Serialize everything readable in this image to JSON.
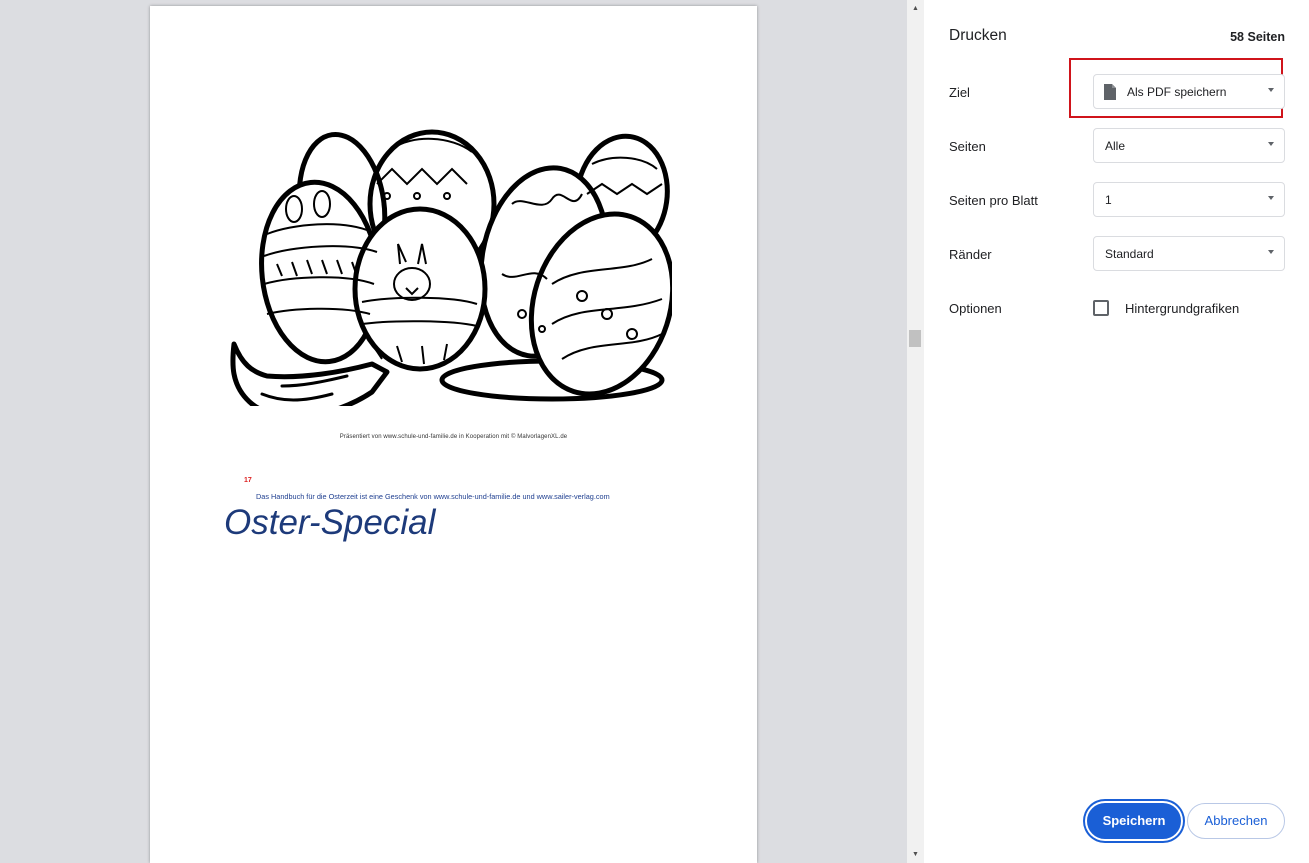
{
  "preview": {
    "credit_line": "Präsentiert von www.schule-und-familie.de in Kooperation mit © MalvorlagenXL.de",
    "page_number": "17",
    "handbook_text": "Das Handbuch für die Osterzeit ist eine Geschenk von www.schule-und-familie.de und www.sailer-verlag.com",
    "headline": "Oster-Special"
  },
  "panel": {
    "title": "Drucken",
    "page_count": "58 Seiten",
    "rows": {
      "destination": {
        "label": "Ziel",
        "value": "Als PDF speichern",
        "icon": "document-icon"
      },
      "pages": {
        "label": "Seiten",
        "value": "Alle"
      },
      "pages_per_sheet": {
        "label": "Seiten pro Blatt",
        "value": "1"
      },
      "margins": {
        "label": "Ränder",
        "value": "Standard"
      },
      "options": {
        "label": "Optionen",
        "checkbox_label": "Hintergrundgrafiken",
        "checked": false
      }
    },
    "buttons": {
      "save": "Speichern",
      "cancel": "Abbrechen"
    }
  },
  "colors": {
    "primary": "#1a5fd6",
    "highlight": "#d0141b",
    "headline": "#1d3a7a"
  }
}
